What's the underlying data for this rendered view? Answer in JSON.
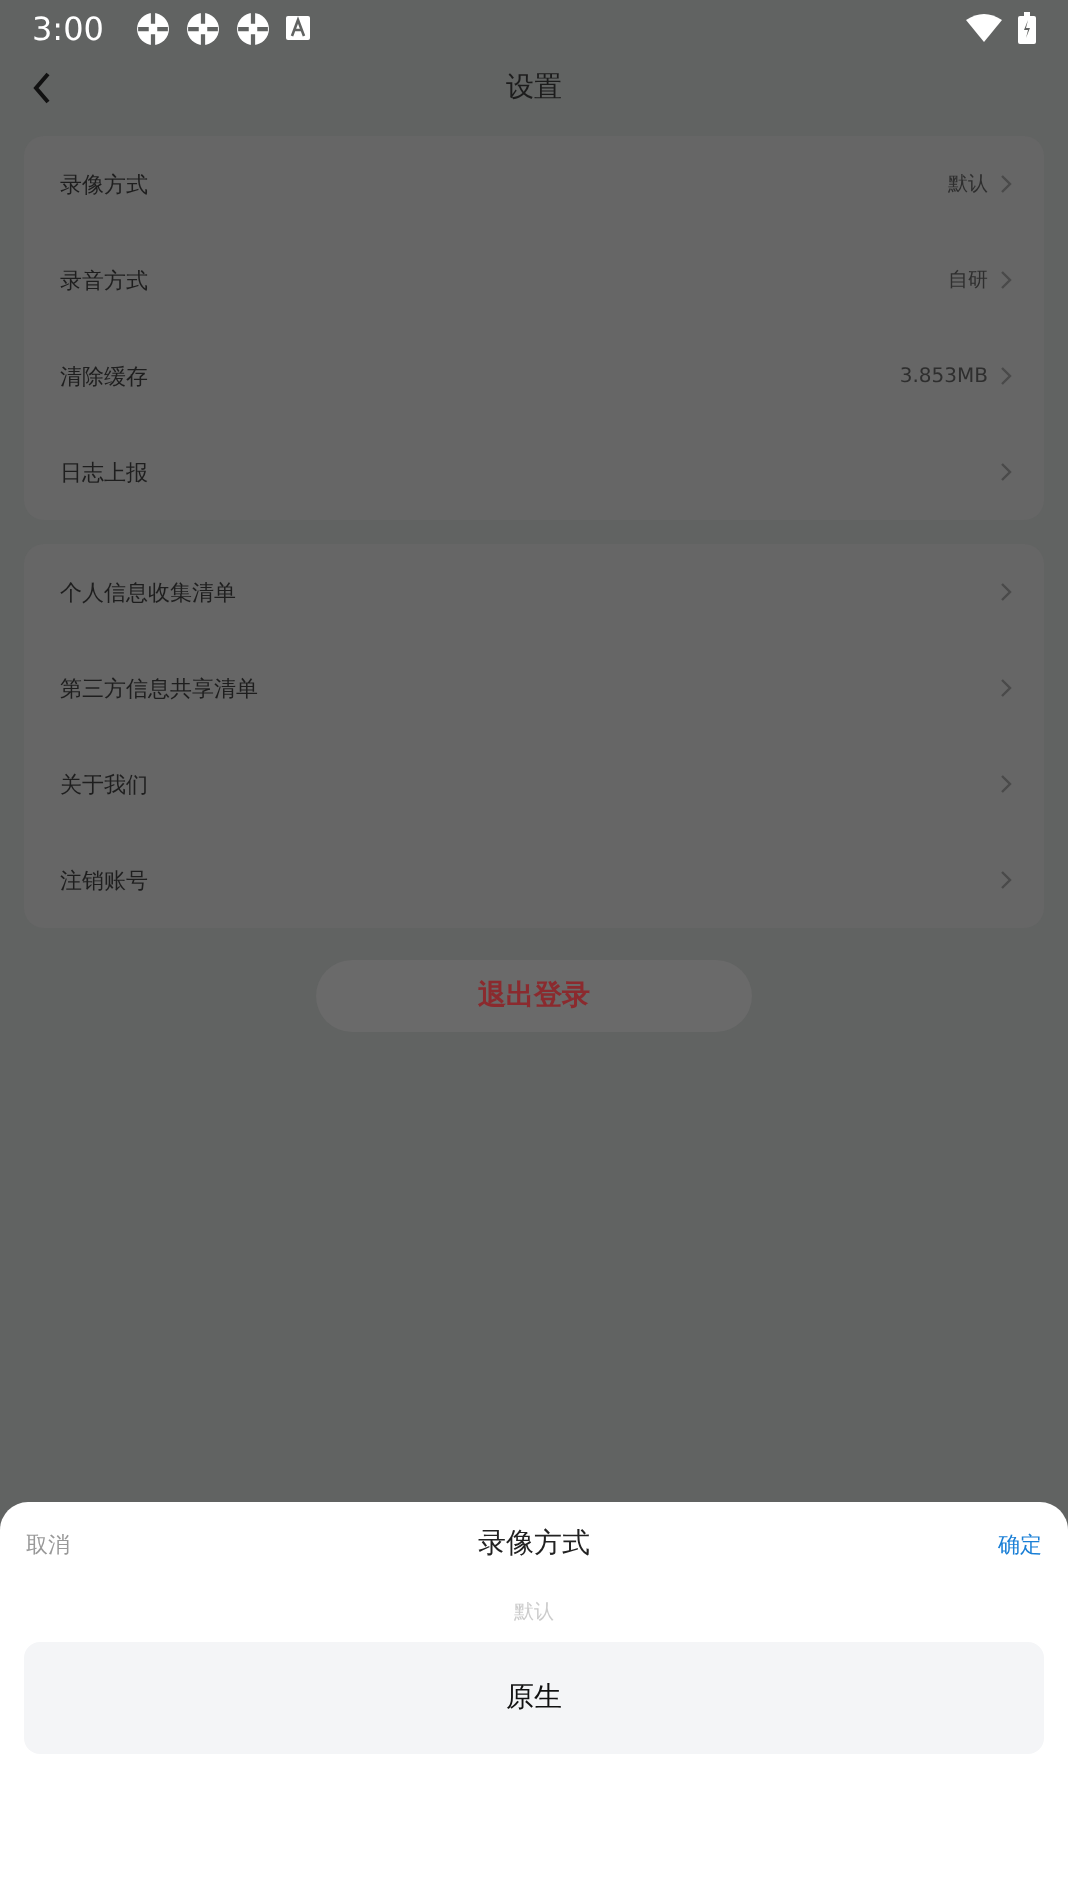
{
  "status_bar": {
    "time": "3:00"
  },
  "header": {
    "title": "设置"
  },
  "groups": [
    {
      "items": [
        {
          "label": "录像方式",
          "value": "默认"
        },
        {
          "label": "录音方式",
          "value": "自研"
        },
        {
          "label": "清除缓存",
          "value": "3.853MB"
        },
        {
          "label": "日志上报"
        }
      ]
    },
    {
      "items": [
        {
          "label": "个人信息收集清单"
        },
        {
          "label": "第三方信息共享清单"
        },
        {
          "label": "关于我们"
        },
        {
          "label": "注销账号"
        }
      ]
    }
  ],
  "logout_button": "退出登录",
  "sheet": {
    "cancel": "取消",
    "title": "录像方式",
    "confirm": "确定",
    "options": [
      {
        "label": "默认",
        "selected": false
      },
      {
        "label": "原生",
        "selected": true
      }
    ]
  }
}
